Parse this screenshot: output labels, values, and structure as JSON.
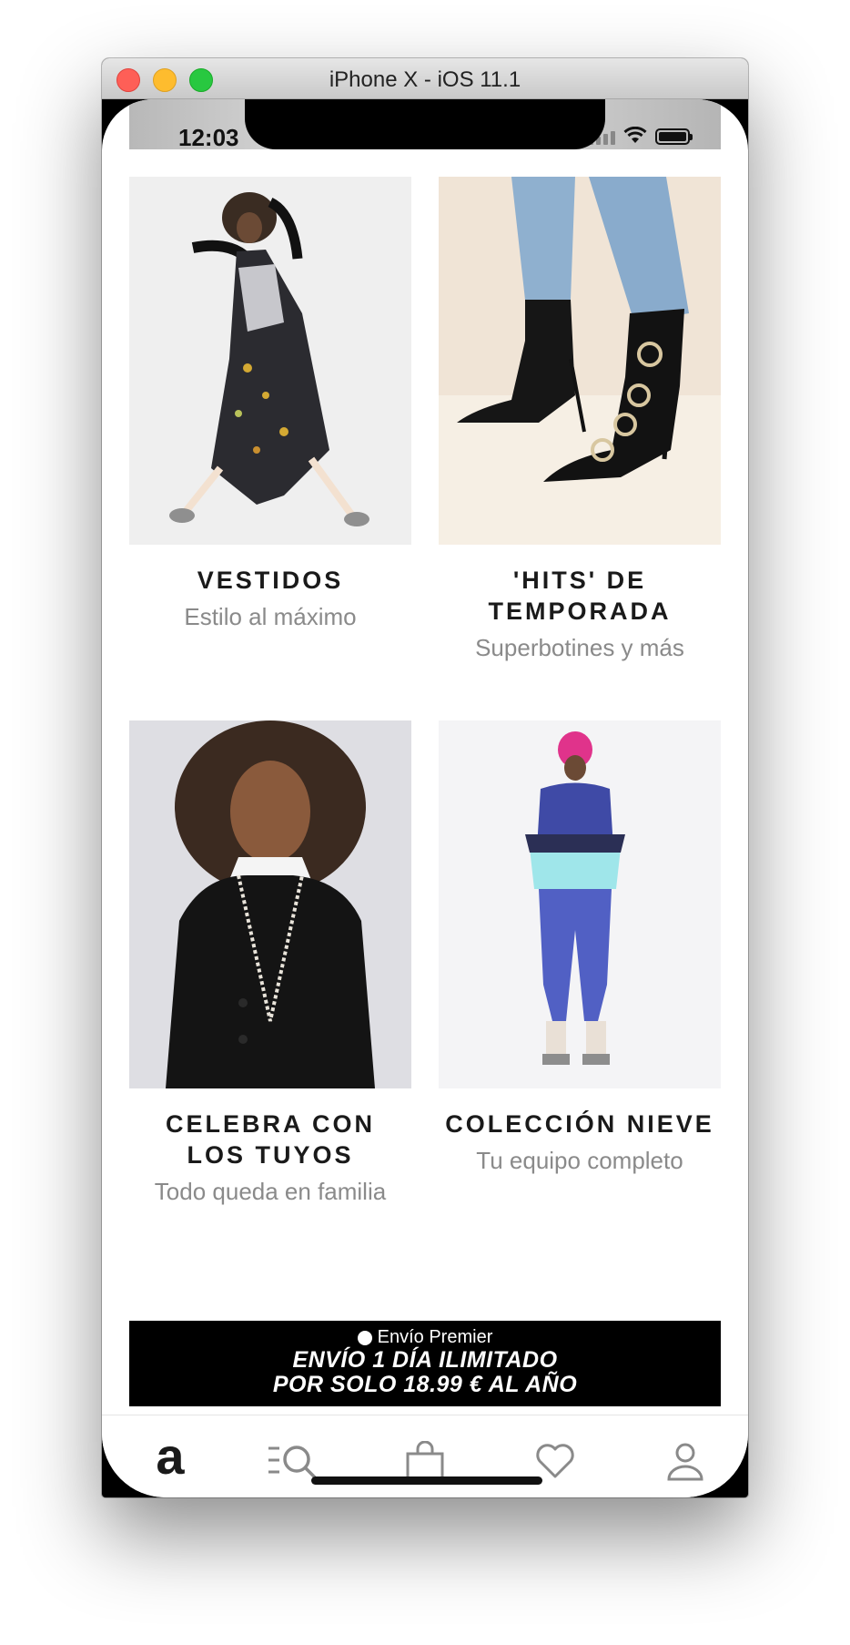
{
  "window": {
    "title": "iPhone X - iOS 11.1"
  },
  "status_bar": {
    "time": "12:03"
  },
  "tiles": [
    {
      "title": "VESTIDOS",
      "subtitle": "Estilo al máximo"
    },
    {
      "title": "'HITS' DE\nTEMPORADA",
      "subtitle": "Superbotines y más"
    },
    {
      "title": "CELEBRA CON\nLOS TUYOS",
      "subtitle": "Todo queda en familia"
    },
    {
      "title": "COLECCIÓN NIEVE",
      "subtitle": "Tu equipo completo"
    }
  ],
  "banner": {
    "brand": "Envío Premier",
    "line1": "ENVÍO 1 DÍA ILIMITADO",
    "line2": "POR SOLO 18.99 €  AL AÑO"
  },
  "tab_bar": {
    "home_logo": "a",
    "items": [
      {
        "icon": "home-logo-icon",
        "active": true
      },
      {
        "icon": "search-list-icon",
        "active": false
      },
      {
        "icon": "shopping-bag-icon",
        "active": false
      },
      {
        "icon": "heart-icon",
        "active": false
      },
      {
        "icon": "user-icon",
        "active": false
      }
    ]
  },
  "colors": {
    "active_tab": "#1a1a1a",
    "inactive_tab": "#8a8a8a",
    "subtitle": "#8a8a8a",
    "banner_bg": "#000000"
  }
}
